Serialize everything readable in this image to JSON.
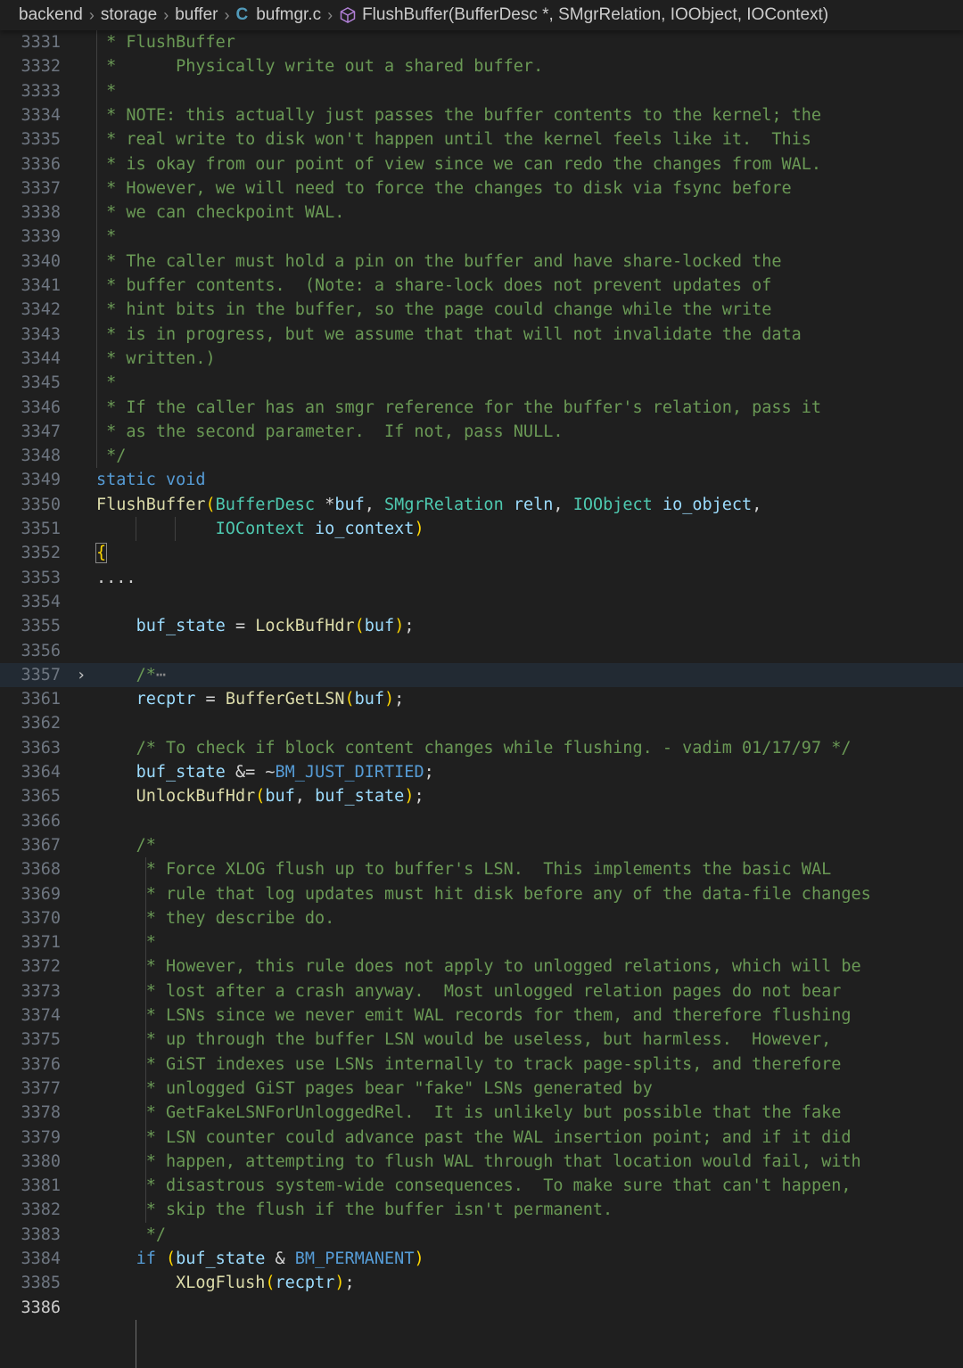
{
  "breadcrumb": {
    "items": [
      "backend",
      "storage",
      "buffer",
      "bufmgr.c"
    ],
    "file_icon": "C",
    "symbol": "FlushBuffer(BufferDesc *, SMgrRelation, IOObject, IOContext)"
  },
  "lines": [
    {
      "n": "3331",
      "indent": 0,
      "tokens": [
        [
          "cm",
          " * FlushBuffer"
        ]
      ]
    },
    {
      "n": "3332",
      "indent": 0,
      "tokens": [
        [
          "cm",
          " *      Physically write out a shared buffer."
        ]
      ]
    },
    {
      "n": "3333",
      "indent": 0,
      "tokens": [
        [
          "cm",
          " *"
        ]
      ]
    },
    {
      "n": "3334",
      "indent": 0,
      "tokens": [
        [
          "cm",
          " * NOTE: this actually just passes the buffer contents to the kernel; the"
        ]
      ]
    },
    {
      "n": "3335",
      "indent": 0,
      "tokens": [
        [
          "cm",
          " * real write to disk won't happen until the kernel feels like it.  This"
        ]
      ]
    },
    {
      "n": "3336",
      "indent": 0,
      "tokens": [
        [
          "cm",
          " * is okay from our point of view since we can redo the changes from WAL."
        ]
      ]
    },
    {
      "n": "3337",
      "indent": 0,
      "tokens": [
        [
          "cm",
          " * However, we will need to force the changes to disk via fsync before"
        ]
      ]
    },
    {
      "n": "3338",
      "indent": 0,
      "tokens": [
        [
          "cm",
          " * we can checkpoint WAL."
        ]
      ]
    },
    {
      "n": "3339",
      "indent": 0,
      "tokens": [
        [
          "cm",
          " *"
        ]
      ]
    },
    {
      "n": "3340",
      "indent": 0,
      "tokens": [
        [
          "cm",
          " * The caller must hold a pin on the buffer and have share-locked the"
        ]
      ]
    },
    {
      "n": "3341",
      "indent": 0,
      "tokens": [
        [
          "cm",
          " * buffer contents.  (Note: a share-lock does not prevent updates of"
        ]
      ]
    },
    {
      "n": "3342",
      "indent": 0,
      "tokens": [
        [
          "cm",
          " * hint bits in the buffer, so the page could change while the write"
        ]
      ]
    },
    {
      "n": "3343",
      "indent": 0,
      "tokens": [
        [
          "cm",
          " * is in progress, but we assume that that will not invalidate the data"
        ]
      ]
    },
    {
      "n": "3344",
      "indent": 0,
      "tokens": [
        [
          "cm",
          " * written.)"
        ]
      ]
    },
    {
      "n": "3345",
      "indent": 0,
      "tokens": [
        [
          "cm",
          " *"
        ]
      ]
    },
    {
      "n": "3346",
      "indent": 0,
      "tokens": [
        [
          "cm",
          " * If the caller has an smgr reference for the buffer's relation, pass it"
        ]
      ]
    },
    {
      "n": "3347",
      "indent": 0,
      "tokens": [
        [
          "cm",
          " * as the second parameter.  If not, pass NULL."
        ]
      ]
    },
    {
      "n": "3348",
      "indent": 0,
      "tokens": [
        [
          "cm",
          " */"
        ]
      ]
    },
    {
      "n": "3349",
      "indent": 0,
      "tokens": [
        [
          "kw",
          "static"
        ],
        [
          "pn",
          " "
        ],
        [
          "kw",
          "void"
        ]
      ]
    },
    {
      "n": "3350",
      "indent": 0,
      "tokens": [
        [
          "fn",
          "FlushBuffer"
        ],
        [
          "br",
          "("
        ],
        [
          "ty",
          "BufferDesc"
        ],
        [
          "pn",
          " *"
        ],
        [
          "vr",
          "buf"
        ],
        [
          "pn",
          ", "
        ],
        [
          "ty",
          "SMgrRelation"
        ],
        [
          "pn",
          " "
        ],
        [
          "vr",
          "reln"
        ],
        [
          "pn",
          ", "
        ],
        [
          "ty",
          "IOObject"
        ],
        [
          "pn",
          " "
        ],
        [
          "vr",
          "io_object"
        ],
        [
          "pn",
          ","
        ]
      ]
    },
    {
      "n": "3351",
      "indent": 0,
      "tokens": [
        [
          "pn",
          "            "
        ],
        [
          "ty",
          "IOContext"
        ],
        [
          "pn",
          " "
        ],
        [
          "vr",
          "io_context"
        ],
        [
          "br",
          ")"
        ]
      ]
    },
    {
      "n": "3352",
      "indent": 0,
      "tokens": [
        [
          "brm",
          "{"
        ]
      ]
    },
    {
      "n": "3353",
      "indent": 0,
      "tokens": [
        [
          "pn",
          "...."
        ]
      ]
    },
    {
      "n": "3354",
      "indent": 0,
      "tokens": []
    },
    {
      "n": "3355",
      "indent": 0,
      "tokens": [
        [
          "pn",
          "    "
        ],
        [
          "vr",
          "buf_state"
        ],
        [
          "pn",
          " = "
        ],
        [
          "fn",
          "LockBufHdr"
        ],
        [
          "br",
          "("
        ],
        [
          "vr",
          "buf"
        ],
        [
          "br",
          ")"
        ],
        [
          "pn",
          ";"
        ]
      ]
    },
    {
      "n": "3356",
      "indent": 0,
      "tokens": []
    },
    {
      "n": "3357",
      "indent": 0,
      "fold": true,
      "highlight": true,
      "tokens": [
        [
          "pn",
          "    "
        ],
        [
          "cm",
          "/*"
        ],
        [
          "ell",
          "⋯"
        ]
      ]
    },
    {
      "n": "3361",
      "indent": 0,
      "tokens": [
        [
          "pn",
          "    "
        ],
        [
          "vr",
          "recptr"
        ],
        [
          "pn",
          " = "
        ],
        [
          "fn",
          "BufferGetLSN"
        ],
        [
          "br",
          "("
        ],
        [
          "vr",
          "buf"
        ],
        [
          "br",
          ")"
        ],
        [
          "pn",
          ";"
        ]
      ]
    },
    {
      "n": "3362",
      "indent": 0,
      "tokens": []
    },
    {
      "n": "3363",
      "indent": 0,
      "tokens": [
        [
          "pn",
          "    "
        ],
        [
          "cm",
          "/* To check if block content changes while flushing. - vadim 01/17/97 */"
        ]
      ]
    },
    {
      "n": "3364",
      "indent": 0,
      "tokens": [
        [
          "pn",
          "    "
        ],
        [
          "vr",
          "buf_state"
        ],
        [
          "pn",
          " &= ~"
        ],
        [
          "mc",
          "BM_JUST_DIRTIED"
        ],
        [
          "pn",
          ";"
        ]
      ]
    },
    {
      "n": "3365",
      "indent": 0,
      "tokens": [
        [
          "pn",
          "    "
        ],
        [
          "fn",
          "UnlockBufHdr"
        ],
        [
          "br",
          "("
        ],
        [
          "vr",
          "buf"
        ],
        [
          "pn",
          ", "
        ],
        [
          "vr",
          "buf_state"
        ],
        [
          "br",
          ")"
        ],
        [
          "pn",
          ";"
        ]
      ]
    },
    {
      "n": "3366",
      "indent": 0,
      "tokens": []
    },
    {
      "n": "3367",
      "indent": 0,
      "tokens": [
        [
          "pn",
          "    "
        ],
        [
          "cm",
          "/*"
        ]
      ]
    },
    {
      "n": "3368",
      "indent": 0,
      "tokens": [
        [
          "pn",
          "    "
        ],
        [
          "cm",
          " * Force XLOG flush up to buffer's LSN.  This implements the basic WAL"
        ]
      ]
    },
    {
      "n": "3369",
      "indent": 0,
      "tokens": [
        [
          "pn",
          "    "
        ],
        [
          "cm",
          " * rule that log updates must hit disk before any of the data-file changes"
        ]
      ]
    },
    {
      "n": "3370",
      "indent": 0,
      "tokens": [
        [
          "pn",
          "    "
        ],
        [
          "cm",
          " * they describe do."
        ]
      ]
    },
    {
      "n": "3371",
      "indent": 0,
      "tokens": [
        [
          "pn",
          "    "
        ],
        [
          "cm",
          " *"
        ]
      ]
    },
    {
      "n": "3372",
      "indent": 0,
      "tokens": [
        [
          "pn",
          "    "
        ],
        [
          "cm",
          " * However, this rule does not apply to unlogged relations, which will be"
        ]
      ]
    },
    {
      "n": "3373",
      "indent": 0,
      "tokens": [
        [
          "pn",
          "    "
        ],
        [
          "cm",
          " * lost after a crash anyway.  Most unlogged relation pages do not bear"
        ]
      ]
    },
    {
      "n": "3374",
      "indent": 0,
      "tokens": [
        [
          "pn",
          "    "
        ],
        [
          "cm",
          " * LSNs since we never emit WAL records for them, and therefore flushing"
        ]
      ]
    },
    {
      "n": "3375",
      "indent": 0,
      "tokens": [
        [
          "pn",
          "    "
        ],
        [
          "cm",
          " * up through the buffer LSN would be useless, but harmless.  However,"
        ]
      ]
    },
    {
      "n": "3376",
      "indent": 0,
      "tokens": [
        [
          "pn",
          "    "
        ],
        [
          "cm",
          " * GiST indexes use LSNs internally to track page-splits, and therefore"
        ]
      ]
    },
    {
      "n": "3377",
      "indent": 0,
      "tokens": [
        [
          "pn",
          "    "
        ],
        [
          "cm",
          " * unlogged GiST pages bear \"fake\" LSNs generated by"
        ]
      ]
    },
    {
      "n": "3378",
      "indent": 0,
      "tokens": [
        [
          "pn",
          "    "
        ],
        [
          "cm",
          " * GetFakeLSNForUnloggedRel.  It is unlikely but possible that the fake"
        ]
      ]
    },
    {
      "n": "3379",
      "indent": 0,
      "tokens": [
        [
          "pn",
          "    "
        ],
        [
          "cm",
          " * LSN counter could advance past the WAL insertion point; and if it did"
        ]
      ]
    },
    {
      "n": "3380",
      "indent": 0,
      "tokens": [
        [
          "pn",
          "    "
        ],
        [
          "cm",
          " * happen, attempting to flush WAL through that location would fail, with"
        ]
      ]
    },
    {
      "n": "3381",
      "indent": 0,
      "tokens": [
        [
          "pn",
          "    "
        ],
        [
          "cm",
          " * disastrous system-wide consequences.  To make sure that can't happen,"
        ]
      ]
    },
    {
      "n": "3382",
      "indent": 0,
      "tokens": [
        [
          "pn",
          "    "
        ],
        [
          "cm",
          " * skip the flush if the buffer isn't permanent."
        ]
      ]
    },
    {
      "n": "3383",
      "indent": 0,
      "tokens": [
        [
          "pn",
          "    "
        ],
        [
          "cm",
          " */"
        ]
      ]
    },
    {
      "n": "3384",
      "indent": 0,
      "tokens": [
        [
          "pn",
          "    "
        ],
        [
          "kw",
          "if"
        ],
        [
          "pn",
          " "
        ],
        [
          "br",
          "("
        ],
        [
          "vr",
          "buf_state"
        ],
        [
          "pn",
          " & "
        ],
        [
          "mc",
          "BM_PERMANENT"
        ],
        [
          "br",
          ")"
        ]
      ]
    },
    {
      "n": "3385",
      "indent": 0,
      "tokens": [
        [
          "pn",
          "        "
        ],
        [
          "fn",
          "XLogFlush"
        ],
        [
          "br",
          "("
        ],
        [
          "vr",
          "recptr"
        ],
        [
          "br",
          ")"
        ],
        [
          "pn",
          ";"
        ]
      ]
    },
    {
      "n": "3386",
      "indent": 0,
      "current": true,
      "tokens": []
    }
  ]
}
